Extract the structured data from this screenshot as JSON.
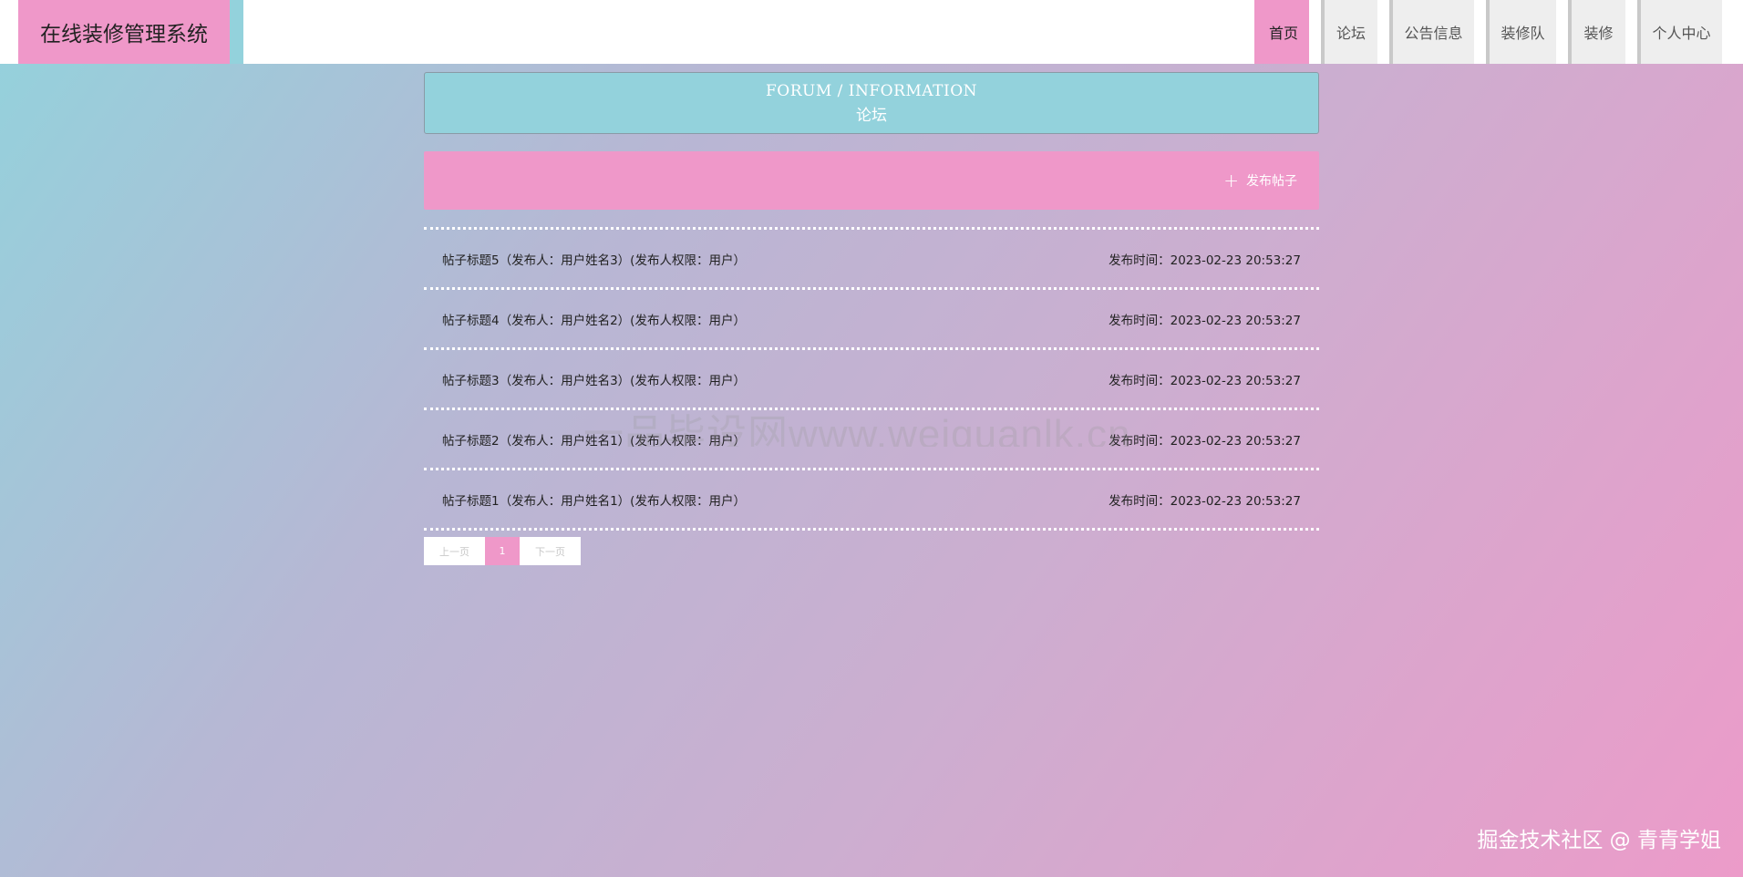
{
  "app": {
    "title": "在线装修管理系统"
  },
  "nav": {
    "items": [
      {
        "label": "首页",
        "active": true
      },
      {
        "label": "论坛",
        "active": false
      },
      {
        "label": "公告信息",
        "active": false
      },
      {
        "label": "装修队",
        "active": false
      },
      {
        "label": "装修",
        "active": false
      },
      {
        "label": "个人中心",
        "active": false
      }
    ]
  },
  "section": {
    "title_en": "FORUM / INFORMATION",
    "title_cn": "论坛"
  },
  "publish": {
    "label": "发布帖子",
    "icon": "plus-icon"
  },
  "posts": [
    {
      "title": "帖子标题5（发布人：用户姓名3）(发布人权限：用户）",
      "time": "发布时间：2023-02-23 20:53:27"
    },
    {
      "title": "帖子标题4（发布人：用户姓名2）(发布人权限：用户）",
      "time": "发布时间：2023-02-23 20:53:27"
    },
    {
      "title": "帖子标题3（发布人：用户姓名3）(发布人权限：用户）",
      "time": "发布时间：2023-02-23 20:53:27"
    },
    {
      "title": "帖子标题2（发布人：用户姓名1）(发布人权限：用户）",
      "time": "发布时间：2023-02-23 20:53:27"
    },
    {
      "title": "帖子标题1（发布人：用户姓名1）(发布人权限：用户）",
      "time": "发布时间：2023-02-23 20:53:27"
    }
  ],
  "pagination": {
    "prev": "上一页",
    "current": "1",
    "next": "下一页"
  },
  "watermark": {
    "center": "一品毕设网www.weiguanlk.cn",
    "corner": "掘金技术社区 @ 青青学姐"
  },
  "colors": {
    "pink": "#ef98c9",
    "teal": "#93d2dc"
  }
}
